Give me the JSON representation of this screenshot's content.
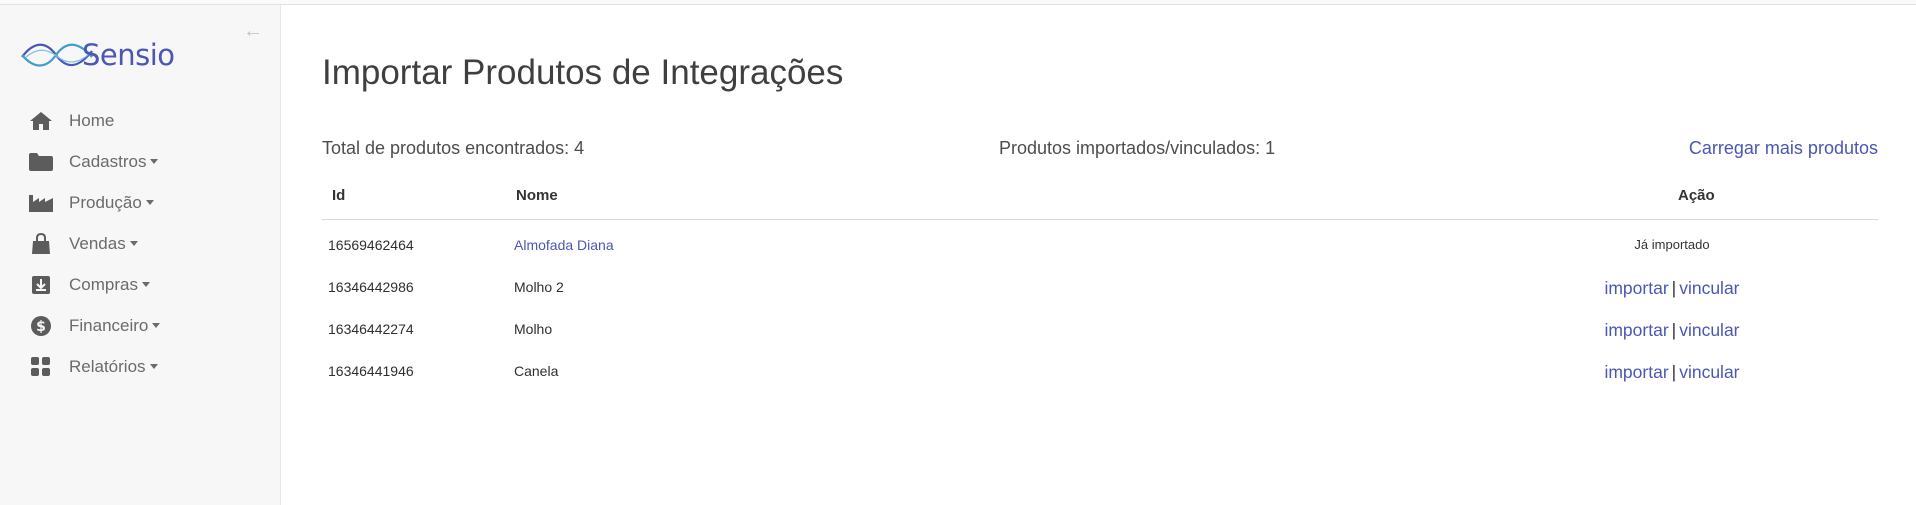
{
  "app": {
    "logo_text": "Sensio"
  },
  "sidebar": {
    "items": [
      {
        "label": "Home",
        "icon": "home-icon",
        "dropdown": false
      },
      {
        "label": "Cadastros",
        "icon": "folder-icon",
        "dropdown": true
      },
      {
        "label": "Produção",
        "icon": "factory-icon",
        "dropdown": true
      },
      {
        "label": "Vendas",
        "icon": "shopping-bag-icon",
        "dropdown": true
      },
      {
        "label": "Compras",
        "icon": "download-box-icon",
        "dropdown": true
      },
      {
        "label": "Financeiro",
        "icon": "dollar-circle-icon",
        "dropdown": true
      },
      {
        "label": "Relatórios",
        "icon": "grid-icon",
        "dropdown": true
      }
    ]
  },
  "page": {
    "title": "Importar Produtos de Integrações",
    "total_found": "Total de produtos encontrados: 4",
    "imported_linked": "Produtos importados/vinculados: 1",
    "load_more": "Carregar mais produtos"
  },
  "table": {
    "headers": {
      "id": "Id",
      "name": "Nome",
      "action": "Ação"
    },
    "rows": [
      {
        "id": "16569462464",
        "name": "Almofada Diana",
        "name_is_link": true,
        "status": "Já importado"
      },
      {
        "id": "16346442986",
        "name": "Molho 2",
        "name_is_link": false,
        "import": "importar",
        "separator": "|",
        "link": "vincular"
      },
      {
        "id": "16346442274",
        "name": "Molho",
        "name_is_link": false,
        "import": "importar",
        "separator": "|",
        "link": "vincular"
      },
      {
        "id": "16346441946",
        "name": "Canela",
        "name_is_link": false,
        "import": "importar",
        "separator": "|",
        "link": "vincular"
      }
    ]
  },
  "colors": {
    "accent": "#4a57b5",
    "sidebar_bg": "#f7f7f7",
    "text": "#333333",
    "muted": "#6b6b6b"
  }
}
